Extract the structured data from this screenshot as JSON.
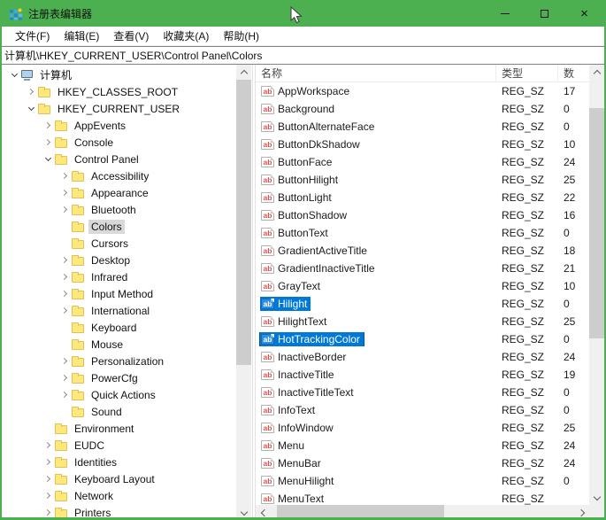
{
  "window": {
    "title": "注册表编辑器",
    "accent_green": "#4caf50",
    "selection_blue": "#0078d7",
    "controls": [
      {
        "name": "minimize"
      },
      {
        "name": "maximize"
      },
      {
        "name": "close"
      }
    ]
  },
  "menubar": {
    "items": [
      {
        "label": "文件(F)"
      },
      {
        "label": "编辑(E)"
      },
      {
        "label": "查看(V)"
      },
      {
        "label": "收藏夹(A)"
      },
      {
        "label": "帮助(H)"
      }
    ]
  },
  "addressbar": {
    "value": "计算机\\HKEY_CURRENT_USER\\Control Panel\\Colors"
  },
  "icons": {
    "reg_sz_glyph": "ab"
  },
  "tree": {
    "items": [
      {
        "label": "计算机",
        "level": 0,
        "expander": "expanded",
        "icon": "computer",
        "selected": false
      },
      {
        "label": "HKEY_CLASSES_ROOT",
        "level": 1,
        "expander": "collapsed",
        "icon": "folder",
        "selected": false
      },
      {
        "label": "HKEY_CURRENT_USER",
        "level": 1,
        "expander": "expanded",
        "icon": "folder",
        "selected": false
      },
      {
        "label": "AppEvents",
        "level": 2,
        "expander": "collapsed",
        "icon": "folder",
        "selected": false
      },
      {
        "label": "Console",
        "level": 2,
        "expander": "collapsed",
        "icon": "folder",
        "selected": false
      },
      {
        "label": "Control Panel",
        "level": 2,
        "expander": "expanded",
        "icon": "folder",
        "selected": false
      },
      {
        "label": "Accessibility",
        "level": 3,
        "expander": "collapsed",
        "icon": "folder",
        "selected": false
      },
      {
        "label": "Appearance",
        "level": 3,
        "expander": "collapsed",
        "icon": "folder",
        "selected": false
      },
      {
        "label": "Bluetooth",
        "level": 3,
        "expander": "collapsed",
        "icon": "folder",
        "selected": false
      },
      {
        "label": "Colors",
        "level": 3,
        "expander": "none",
        "icon": "folder",
        "selected": true
      },
      {
        "label": "Cursors",
        "level": 3,
        "expander": "none",
        "icon": "folder",
        "selected": false
      },
      {
        "label": "Desktop",
        "level": 3,
        "expander": "collapsed",
        "icon": "folder",
        "selected": false
      },
      {
        "label": "Infrared",
        "level": 3,
        "expander": "collapsed",
        "icon": "folder",
        "selected": false
      },
      {
        "label": "Input Method",
        "level": 3,
        "expander": "collapsed",
        "icon": "folder",
        "selected": false
      },
      {
        "label": "International",
        "level": 3,
        "expander": "collapsed",
        "icon": "folder",
        "selected": false
      },
      {
        "label": "Keyboard",
        "level": 3,
        "expander": "none",
        "icon": "folder",
        "selected": false
      },
      {
        "label": "Mouse",
        "level": 3,
        "expander": "none",
        "icon": "folder",
        "selected": false
      },
      {
        "label": "Personalization",
        "level": 3,
        "expander": "collapsed",
        "icon": "folder",
        "selected": false
      },
      {
        "label": "PowerCfg",
        "level": 3,
        "expander": "collapsed",
        "icon": "folder",
        "selected": false
      },
      {
        "label": "Quick Actions",
        "level": 3,
        "expander": "collapsed",
        "icon": "folder",
        "selected": false
      },
      {
        "label": "Sound",
        "level": 3,
        "expander": "none",
        "icon": "folder",
        "selected": false
      },
      {
        "label": "Environment",
        "level": 2,
        "expander": "none",
        "icon": "folder",
        "selected": false
      },
      {
        "label": "EUDC",
        "level": 2,
        "expander": "collapsed",
        "icon": "folder",
        "selected": false
      },
      {
        "label": "Identities",
        "level": 2,
        "expander": "collapsed",
        "icon": "folder",
        "selected": false
      },
      {
        "label": "Keyboard Layout",
        "level": 2,
        "expander": "collapsed",
        "icon": "folder",
        "selected": false
      },
      {
        "label": "Network",
        "level": 2,
        "expander": "collapsed",
        "icon": "folder",
        "selected": false
      },
      {
        "label": "Printers",
        "level": 2,
        "expander": "collapsed",
        "icon": "folder",
        "selected": false
      }
    ]
  },
  "list": {
    "columns": [
      {
        "label": "名称"
      },
      {
        "label": "类型"
      },
      {
        "label": "数"
      }
    ],
    "rows": [
      {
        "name": "AppWorkspace",
        "type": "REG_SZ",
        "data": "17",
        "selected": false,
        "focused": false
      },
      {
        "name": "Background",
        "type": "REG_SZ",
        "data": "0",
        "selected": false,
        "focused": false
      },
      {
        "name": "ButtonAlternateFace",
        "type": "REG_SZ",
        "data": "0",
        "selected": false,
        "focused": false
      },
      {
        "name": "ButtonDkShadow",
        "type": "REG_SZ",
        "data": "10",
        "selected": false,
        "focused": false
      },
      {
        "name": "ButtonFace",
        "type": "REG_SZ",
        "data": "24",
        "selected": false,
        "focused": false
      },
      {
        "name": "ButtonHilight",
        "type": "REG_SZ",
        "data": "25",
        "selected": false,
        "focused": false
      },
      {
        "name": "ButtonLight",
        "type": "REG_SZ",
        "data": "22",
        "selected": false,
        "focused": false
      },
      {
        "name": "ButtonShadow",
        "type": "REG_SZ",
        "data": "16",
        "selected": false,
        "focused": false
      },
      {
        "name": "ButtonText",
        "type": "REG_SZ",
        "data": "0",
        "selected": false,
        "focused": false
      },
      {
        "name": "GradientActiveTitle",
        "type": "REG_SZ",
        "data": "18",
        "selected": false,
        "focused": false
      },
      {
        "name": "GradientInactiveTitle",
        "type": "REG_SZ",
        "data": "21",
        "selected": false,
        "focused": false
      },
      {
        "name": "GrayText",
        "type": "REG_SZ",
        "data": "10",
        "selected": false,
        "focused": false
      },
      {
        "name": "Hilight",
        "type": "REG_SZ",
        "data": "0",
        "selected": true,
        "focused": false
      },
      {
        "name": "HilightText",
        "type": "REG_SZ",
        "data": "25",
        "selected": false,
        "focused": false
      },
      {
        "name": "HotTrackingColor",
        "type": "REG_SZ",
        "data": "0",
        "selected": true,
        "focused": true
      },
      {
        "name": "InactiveBorder",
        "type": "REG_SZ",
        "data": "24",
        "selected": false,
        "focused": false
      },
      {
        "name": "InactiveTitle",
        "type": "REG_SZ",
        "data": "19",
        "selected": false,
        "focused": false
      },
      {
        "name": "InactiveTitleText",
        "type": "REG_SZ",
        "data": "0",
        "selected": false,
        "focused": false
      },
      {
        "name": "InfoText",
        "type": "REG_SZ",
        "data": "0",
        "selected": false,
        "focused": false
      },
      {
        "name": "InfoWindow",
        "type": "REG_SZ",
        "data": "25",
        "selected": false,
        "focused": false
      },
      {
        "name": "Menu",
        "type": "REG_SZ",
        "data": "24",
        "selected": false,
        "focused": false
      },
      {
        "name": "MenuBar",
        "type": "REG_SZ",
        "data": "24",
        "selected": false,
        "focused": false
      },
      {
        "name": "MenuHilight",
        "type": "REG_SZ",
        "data": "0",
        "selected": false,
        "focused": false
      },
      {
        "name": "MenuText",
        "type": "REG_SZ",
        "data": "",
        "selected": false,
        "focused": false
      }
    ]
  }
}
